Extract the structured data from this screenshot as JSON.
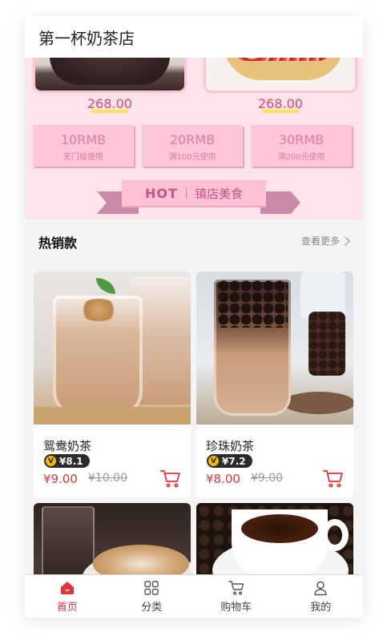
{
  "header": {
    "title": "第一杯奶茶店"
  },
  "promo": {
    "cake_prices": [
      "268.00",
      "268.00"
    ],
    "coupons": [
      {
        "amount": "10RMB",
        "condition": "无门槛使用"
      },
      {
        "amount": "20RMB",
        "condition": "满100元使用"
      },
      {
        "amount": "30RMB",
        "condition": "满200元使用"
      }
    ],
    "banner": {
      "hot": "HOT",
      "text": "镇店美食"
    }
  },
  "section": {
    "title": "热销款",
    "more": "查看更多"
  },
  "products": [
    {
      "name": "鸳鸯奶茶",
      "vip_badge": "V",
      "vip_price": "¥8.1",
      "price": "¥9.00",
      "old_price": "¥10.00"
    },
    {
      "name": "珍珠奶茶",
      "vip_badge": "V",
      "vip_price": "¥7.2",
      "price": "¥8.00",
      "old_price": "¥9.00"
    }
  ],
  "tabs": [
    {
      "label": "首页",
      "icon": "home-icon",
      "active": true
    },
    {
      "label": "分类",
      "icon": "grid-icon",
      "active": false
    },
    {
      "label": "购物车",
      "icon": "cart-icon",
      "active": false
    },
    {
      "label": "我的",
      "icon": "user-icon",
      "active": false
    }
  ],
  "colors": {
    "accent": "#e0353a",
    "promo_bg": "#ffe3ea",
    "coupon": "#ffc6d8",
    "vip_gold": "#f5b800"
  }
}
